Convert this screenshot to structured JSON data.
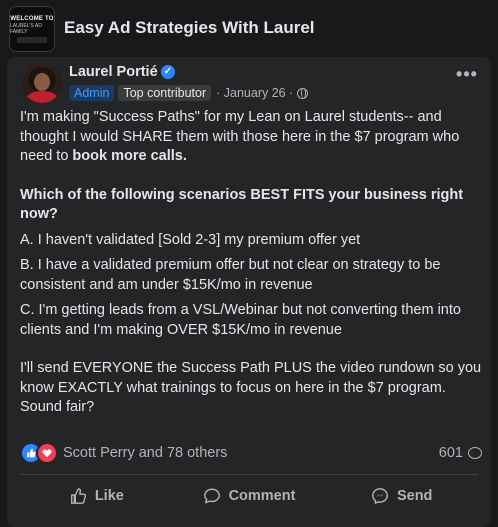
{
  "group": {
    "title": "Easy Ad Strategies With Laurel",
    "logo_line1": "WELCOME TO",
    "logo_line2": "LAUREL'S AD FAMILY"
  },
  "post": {
    "author": "Laurel Portié",
    "badge_admin": "Admin",
    "badge_top": "Top contributor",
    "date": "· January 26 ·",
    "paragraph1_pre": "I'm making \"Success Paths\" for my Lean on Laurel students-- and thought I would SHARE them with those here in the $7 program who need to ",
    "paragraph1_bold": "book more calls.",
    "question": "Which of the following scenarios BEST FITS your business right now?",
    "option_a": "A. I haven't validated [Sold 2-3] my premium offer yet",
    "option_b": "B. I have a validated premium offer but not clear on strategy to be consistent and am under $15K/mo in revenue",
    "option_c": "C. I'm getting leads from a VSL/Webinar but not converting them into clients and I'm making OVER $15K/mo in revenue",
    "closing": "I'll send EVERYONE the Success Path PLUS the video rundown so you know EXACTLY what trainings to focus on here in the $7 program. Sound fair?"
  },
  "engagement": {
    "reactions_text": "Scott Perry and 78 others",
    "comment_count": "601"
  },
  "actions": {
    "like": "Like",
    "comment": "Comment",
    "send": "Send"
  },
  "colors": {
    "background": "#18191a",
    "card": "#242526",
    "accent": "#2d88ff",
    "love": "#f33e58"
  }
}
